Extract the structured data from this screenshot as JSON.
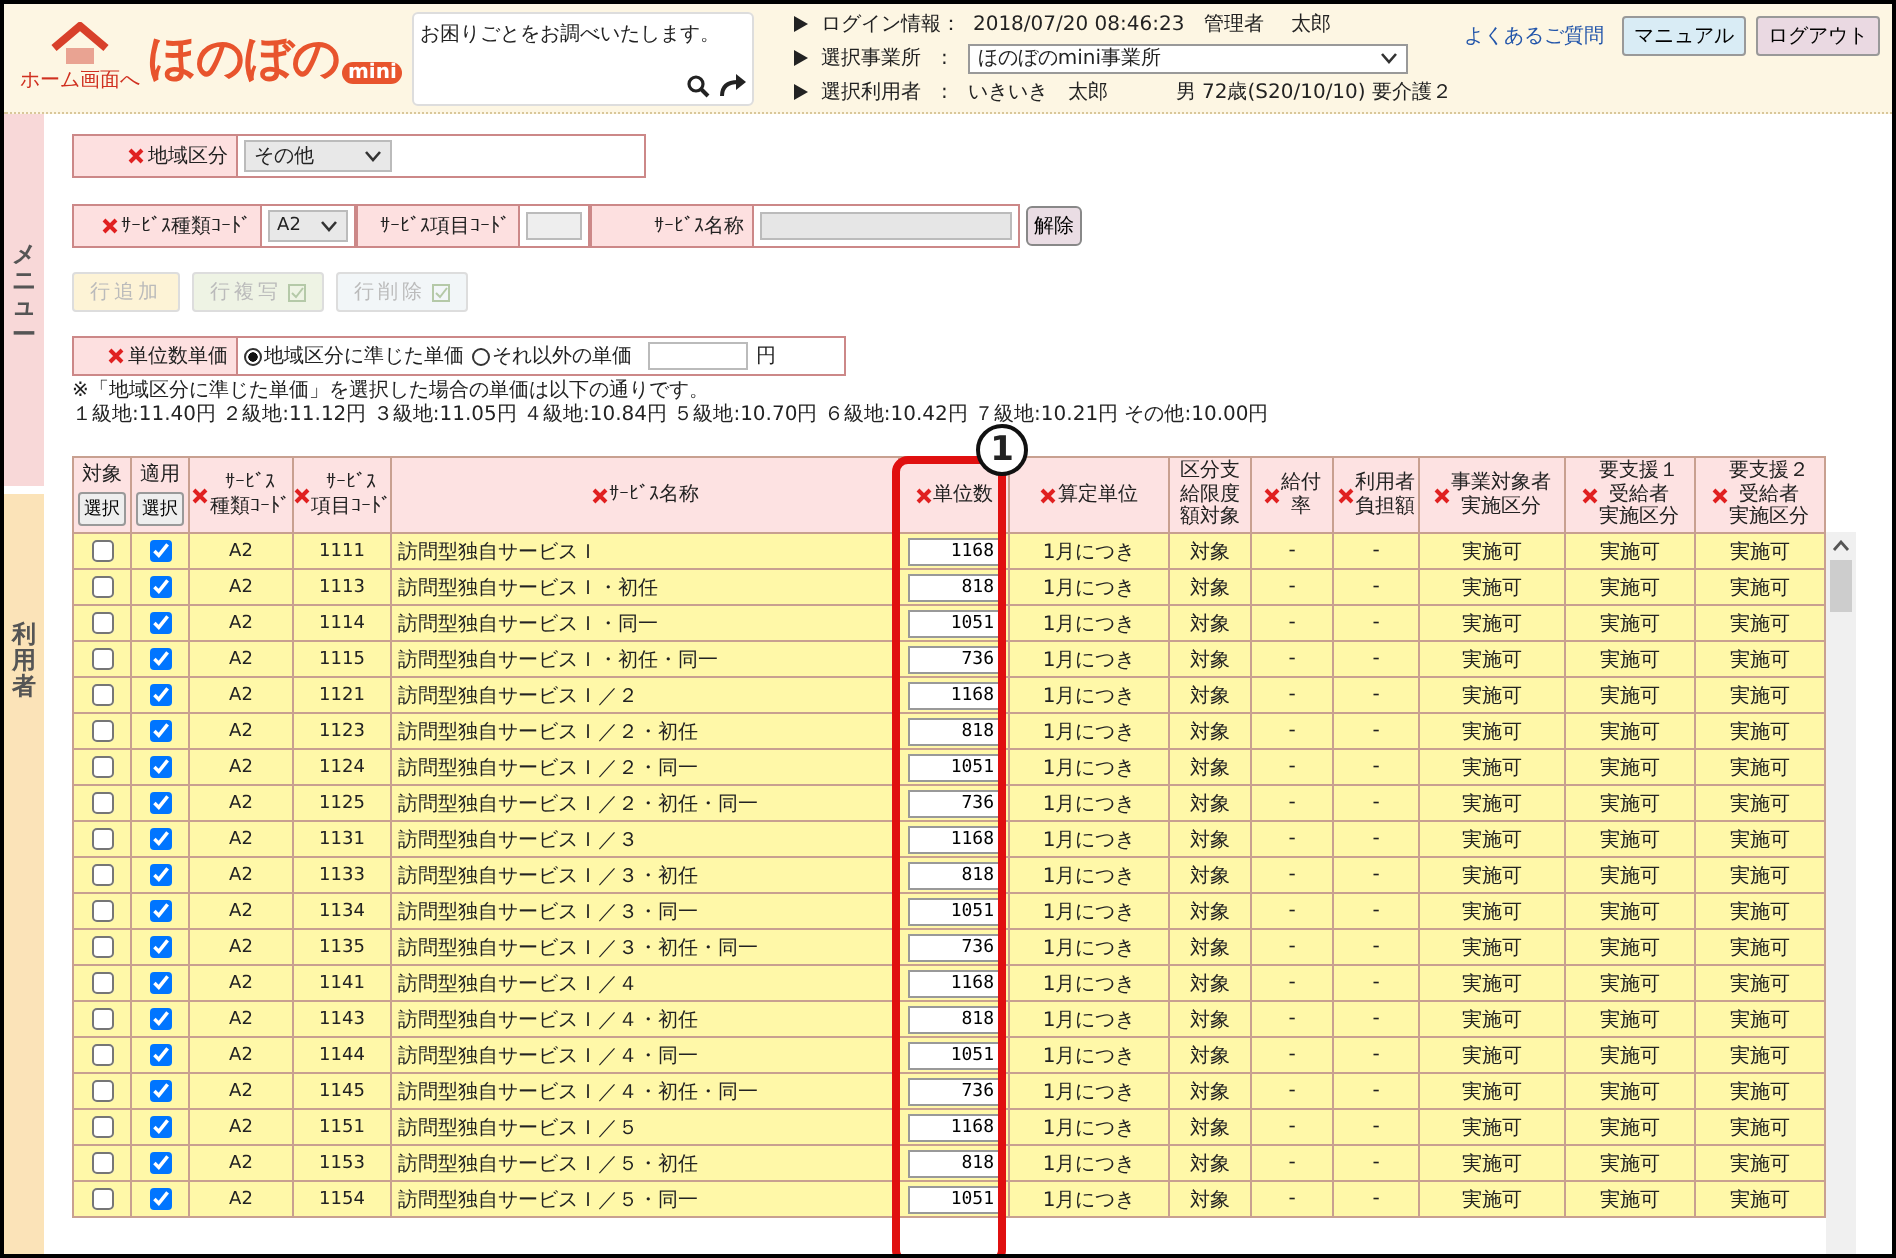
{
  "header": {
    "home_label": "ホーム画面へ",
    "logo": "ほのぼの",
    "logo_sub": "mini",
    "search": {
      "placeholder": "お困りごとをお調べいたします。"
    },
    "info": [
      {
        "label": "ログイン情報：",
        "kind": "text",
        "value": "2018/07/20 08:46:23　管理者　 太郎"
      },
      {
        "label": "選択事業所",
        "sep": ":",
        "kind": "select",
        "value": "ほのぼのmini事業所"
      },
      {
        "label": "選択利用者",
        "sep": ":",
        "kind": "text",
        "value": "いきいき　太郎",
        "extra": "男 72歳(S20/10/10) 要介護２"
      }
    ],
    "faq": "よくあるご質問",
    "buttons": [
      {
        "label": "マニュアル",
        "kind": "manual"
      },
      {
        "label": "ログアウト",
        "kind": "logout"
      }
    ]
  },
  "side_tabs": [
    {
      "label": "メニュー",
      "kind": "menu"
    },
    {
      "label": "利用者",
      "kind": "user"
    }
  ],
  "form": {
    "area": {
      "label": "地域区分",
      "required": true,
      "value": "その他"
    },
    "service_filter": [
      {
        "label": "ｻｰﾋﾞｽ種類ｺｰﾄﾞ",
        "required": true,
        "kind": "select",
        "value": "A2"
      },
      {
        "label": "ｻｰﾋﾞｽ項目ｺｰﾄﾞ",
        "required": false,
        "kind": "input"
      },
      {
        "label": "ｻｰﾋﾞｽ名称",
        "required": false,
        "kind": "wide"
      }
    ],
    "clear_button": "解除",
    "row_buttons": [
      {
        "label": "行追加",
        "kind": "plain",
        "disabled": true,
        "color": "#fdf3d6"
      },
      {
        "label": "行複写",
        "kind": "check",
        "disabled": true,
        "color": "#eef3e4"
      },
      {
        "label": "行削除",
        "kind": "check",
        "disabled": true,
        "color": "#f2f6f8"
      }
    ],
    "unit_price": {
      "label": "単位数単価",
      "required": true,
      "options": [
        {
          "label": "地域区分に準じた単価",
          "selected": true
        },
        {
          "label": "それ以外の単価",
          "selected": false
        }
      ],
      "suffix": "円"
    },
    "notes": [
      "※「地域区分に準じた単価」を選択した場合の単価は以下の通りです。",
      "１級地:11.40円 ２級地:11.12円 ３級地:11.05円 ４級地:10.84円 ５級地:10.70円 ６級地:10.42円 ７級地:10.21円 その他:10.00円"
    ]
  },
  "table": {
    "columns": [
      {
        "label": "対象",
        "required": false,
        "button": "選択"
      },
      {
        "label": "適用",
        "required": false,
        "button": "選択"
      },
      {
        "lines": [
          "ｻｰﾋﾞｽ",
          "種類ｺｰﾄﾞ"
        ],
        "required": true
      },
      {
        "lines": [
          "ｻｰﾋﾞｽ",
          "項目ｺｰﾄﾞ"
        ],
        "required": true
      },
      {
        "label": "ｻｰﾋﾞｽ名称",
        "required": true
      },
      {
        "label": "単位数",
        "required": true
      },
      {
        "label": "算定単位",
        "required": true
      },
      {
        "lines": [
          "区分支",
          "給限度",
          "額対象"
        ],
        "required": false
      },
      {
        "lines": [
          "給付",
          "率"
        ],
        "required": true
      },
      {
        "lines": [
          "利用者",
          "負担額"
        ],
        "required": true
      },
      {
        "lines": [
          "事業対象者",
          "実施区分"
        ],
        "required": true
      },
      {
        "lines": [
          "要支援１",
          "受給者",
          "実施区分"
        ],
        "required": true
      },
      {
        "lines": [
          "要支援２",
          "受給者",
          "実施区分"
        ],
        "required": true
      }
    ],
    "rows": [
      {
        "target": false,
        "apply": true,
        "type_code": "A2",
        "item_code": "1111",
        "name": "訪問型独自サービスＩ",
        "units": "1168",
        "calc": "1月につき",
        "limit": "対象",
        "rate": "-",
        "burden": "-",
        "c1": "実施可",
        "c2": "実施可",
        "c3": "実施可"
      },
      {
        "target": false,
        "apply": true,
        "type_code": "A2",
        "item_code": "1113",
        "name": "訪問型独自サービスＩ・初任",
        "units": "818",
        "calc": "1月につき",
        "limit": "対象",
        "rate": "-",
        "burden": "-",
        "c1": "実施可",
        "c2": "実施可",
        "c3": "実施可"
      },
      {
        "target": false,
        "apply": true,
        "type_code": "A2",
        "item_code": "1114",
        "name": "訪問型独自サービスＩ・同一",
        "units": "1051",
        "calc": "1月につき",
        "limit": "対象",
        "rate": "-",
        "burden": "-",
        "c1": "実施可",
        "c2": "実施可",
        "c3": "実施可"
      },
      {
        "target": false,
        "apply": true,
        "type_code": "A2",
        "item_code": "1115",
        "name": "訪問型独自サービスＩ・初任・同一",
        "units": "736",
        "calc": "1月につき",
        "limit": "対象",
        "rate": "-",
        "burden": "-",
        "c1": "実施可",
        "c2": "実施可",
        "c3": "実施可"
      },
      {
        "target": false,
        "apply": true,
        "type_code": "A2",
        "item_code": "1121",
        "name": "訪問型独自サービスＩ／２",
        "units": "1168",
        "calc": "1月につき",
        "limit": "対象",
        "rate": "-",
        "burden": "-",
        "c1": "実施可",
        "c2": "実施可",
        "c3": "実施可"
      },
      {
        "target": false,
        "apply": true,
        "type_code": "A2",
        "item_code": "1123",
        "name": "訪問型独自サービスＩ／２・初任",
        "units": "818",
        "calc": "1月につき",
        "limit": "対象",
        "rate": "-",
        "burden": "-",
        "c1": "実施可",
        "c2": "実施可",
        "c3": "実施可"
      },
      {
        "target": false,
        "apply": true,
        "type_code": "A2",
        "item_code": "1124",
        "name": "訪問型独自サービスＩ／２・同一",
        "units": "1051",
        "calc": "1月につき",
        "limit": "対象",
        "rate": "-",
        "burden": "-",
        "c1": "実施可",
        "c2": "実施可",
        "c3": "実施可"
      },
      {
        "target": false,
        "apply": true,
        "type_code": "A2",
        "item_code": "1125",
        "name": "訪問型独自サービスＩ／２・初任・同一",
        "units": "736",
        "calc": "1月につき",
        "limit": "対象",
        "rate": "-",
        "burden": "-",
        "c1": "実施可",
        "c2": "実施可",
        "c3": "実施可"
      },
      {
        "target": false,
        "apply": true,
        "type_code": "A2",
        "item_code": "1131",
        "name": "訪問型独自サービスＩ／３",
        "units": "1168",
        "calc": "1月につき",
        "limit": "対象",
        "rate": "-",
        "burden": "-",
        "c1": "実施可",
        "c2": "実施可",
        "c3": "実施可"
      },
      {
        "target": false,
        "apply": true,
        "type_code": "A2",
        "item_code": "1133",
        "name": "訪問型独自サービスＩ／３・初任",
        "units": "818",
        "calc": "1月につき",
        "limit": "対象",
        "rate": "-",
        "burden": "-",
        "c1": "実施可",
        "c2": "実施可",
        "c3": "実施可"
      },
      {
        "target": false,
        "apply": true,
        "type_code": "A2",
        "item_code": "1134",
        "name": "訪問型独自サービスＩ／３・同一",
        "units": "1051",
        "calc": "1月につき",
        "limit": "対象",
        "rate": "-",
        "burden": "-",
        "c1": "実施可",
        "c2": "実施可",
        "c3": "実施可"
      },
      {
        "target": false,
        "apply": true,
        "type_code": "A2",
        "item_code": "1135",
        "name": "訪問型独自サービスＩ／３・初任・同一",
        "units": "736",
        "calc": "1月につき",
        "limit": "対象",
        "rate": "-",
        "burden": "-",
        "c1": "実施可",
        "c2": "実施可",
        "c3": "実施可"
      },
      {
        "target": false,
        "apply": true,
        "type_code": "A2",
        "item_code": "1141",
        "name": "訪問型独自サービスＩ／４",
        "units": "1168",
        "calc": "1月につき",
        "limit": "対象",
        "rate": "-",
        "burden": "-",
        "c1": "実施可",
        "c2": "実施可",
        "c3": "実施可"
      },
      {
        "target": false,
        "apply": true,
        "type_code": "A2",
        "item_code": "1143",
        "name": "訪問型独自サービスＩ／４・初任",
        "units": "818",
        "calc": "1月につき",
        "limit": "対象",
        "rate": "-",
        "burden": "-",
        "c1": "実施可",
        "c2": "実施可",
        "c3": "実施可"
      },
      {
        "target": false,
        "apply": true,
        "type_code": "A2",
        "item_code": "1144",
        "name": "訪問型独自サービスＩ／４・同一",
        "units": "1051",
        "calc": "1月につき",
        "limit": "対象",
        "rate": "-",
        "burden": "-",
        "c1": "実施可",
        "c2": "実施可",
        "c3": "実施可"
      },
      {
        "target": false,
        "apply": true,
        "type_code": "A2",
        "item_code": "1145",
        "name": "訪問型独自サービスＩ／４・初任・同一",
        "units": "736",
        "calc": "1月につき",
        "limit": "対象",
        "rate": "-",
        "burden": "-",
        "c1": "実施可",
        "c2": "実施可",
        "c3": "実施可"
      },
      {
        "target": false,
        "apply": true,
        "type_code": "A2",
        "item_code": "1151",
        "name": "訪問型独自サービスＩ／５",
        "units": "1168",
        "calc": "1月につき",
        "limit": "対象",
        "rate": "-",
        "burden": "-",
        "c1": "実施可",
        "c2": "実施可",
        "c3": "実施可"
      },
      {
        "target": false,
        "apply": true,
        "type_code": "A2",
        "item_code": "1153",
        "name": "訪問型独自サービスＩ／５・初任",
        "units": "818",
        "calc": "1月につき",
        "limit": "対象",
        "rate": "-",
        "burden": "-",
        "c1": "実施可",
        "c2": "実施可",
        "c3": "実施可"
      },
      {
        "target": false,
        "apply": true,
        "type_code": "A2",
        "item_code": "1154",
        "name": "訪問型独自サービスＩ／５・同一",
        "units": "1051",
        "calc": "1月につき",
        "limit": "対象",
        "rate": "-",
        "burden": "-",
        "c1": "実施可",
        "c2": "実施可",
        "c3": "実施可"
      }
    ]
  },
  "annotation": {
    "label": "1"
  }
}
